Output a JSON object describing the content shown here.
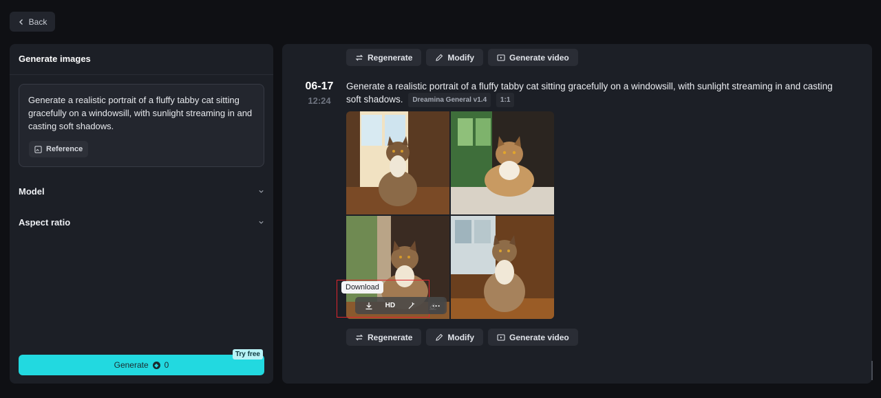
{
  "nav": {
    "back_label": "Back"
  },
  "left": {
    "title": "Generate images",
    "prompt": "Generate a realistic portrait of a fluffy tabby cat sitting gracefully on a windowsill, with sunlight streaming in and casting soft shadows.",
    "reference_label": "Reference",
    "model_label": "Model",
    "aspect_label": "Aspect ratio",
    "generate_label": "Generate",
    "generate_cost": "0",
    "try_free_label": "Try free"
  },
  "result": {
    "date": "06-17",
    "time": "12:24",
    "prompt": "Generate a realistic portrait of a fluffy tabby cat sitting gracefully on a windowsill, with sunlight streaming in and casting soft shadows.",
    "model_tag": "Dreamina General v1.4",
    "ratio_tag": "1:1",
    "regenerate_label": "Regenerate",
    "modify_label": "Modify",
    "video_label": "Generate video",
    "tooltip": "Download",
    "hd_label": "HD",
    "more_label": "···"
  },
  "colors": {
    "accent": "#22d9e0",
    "panel": "#1c1f26",
    "background": "#0f1014",
    "highlight": "#e0262e"
  }
}
